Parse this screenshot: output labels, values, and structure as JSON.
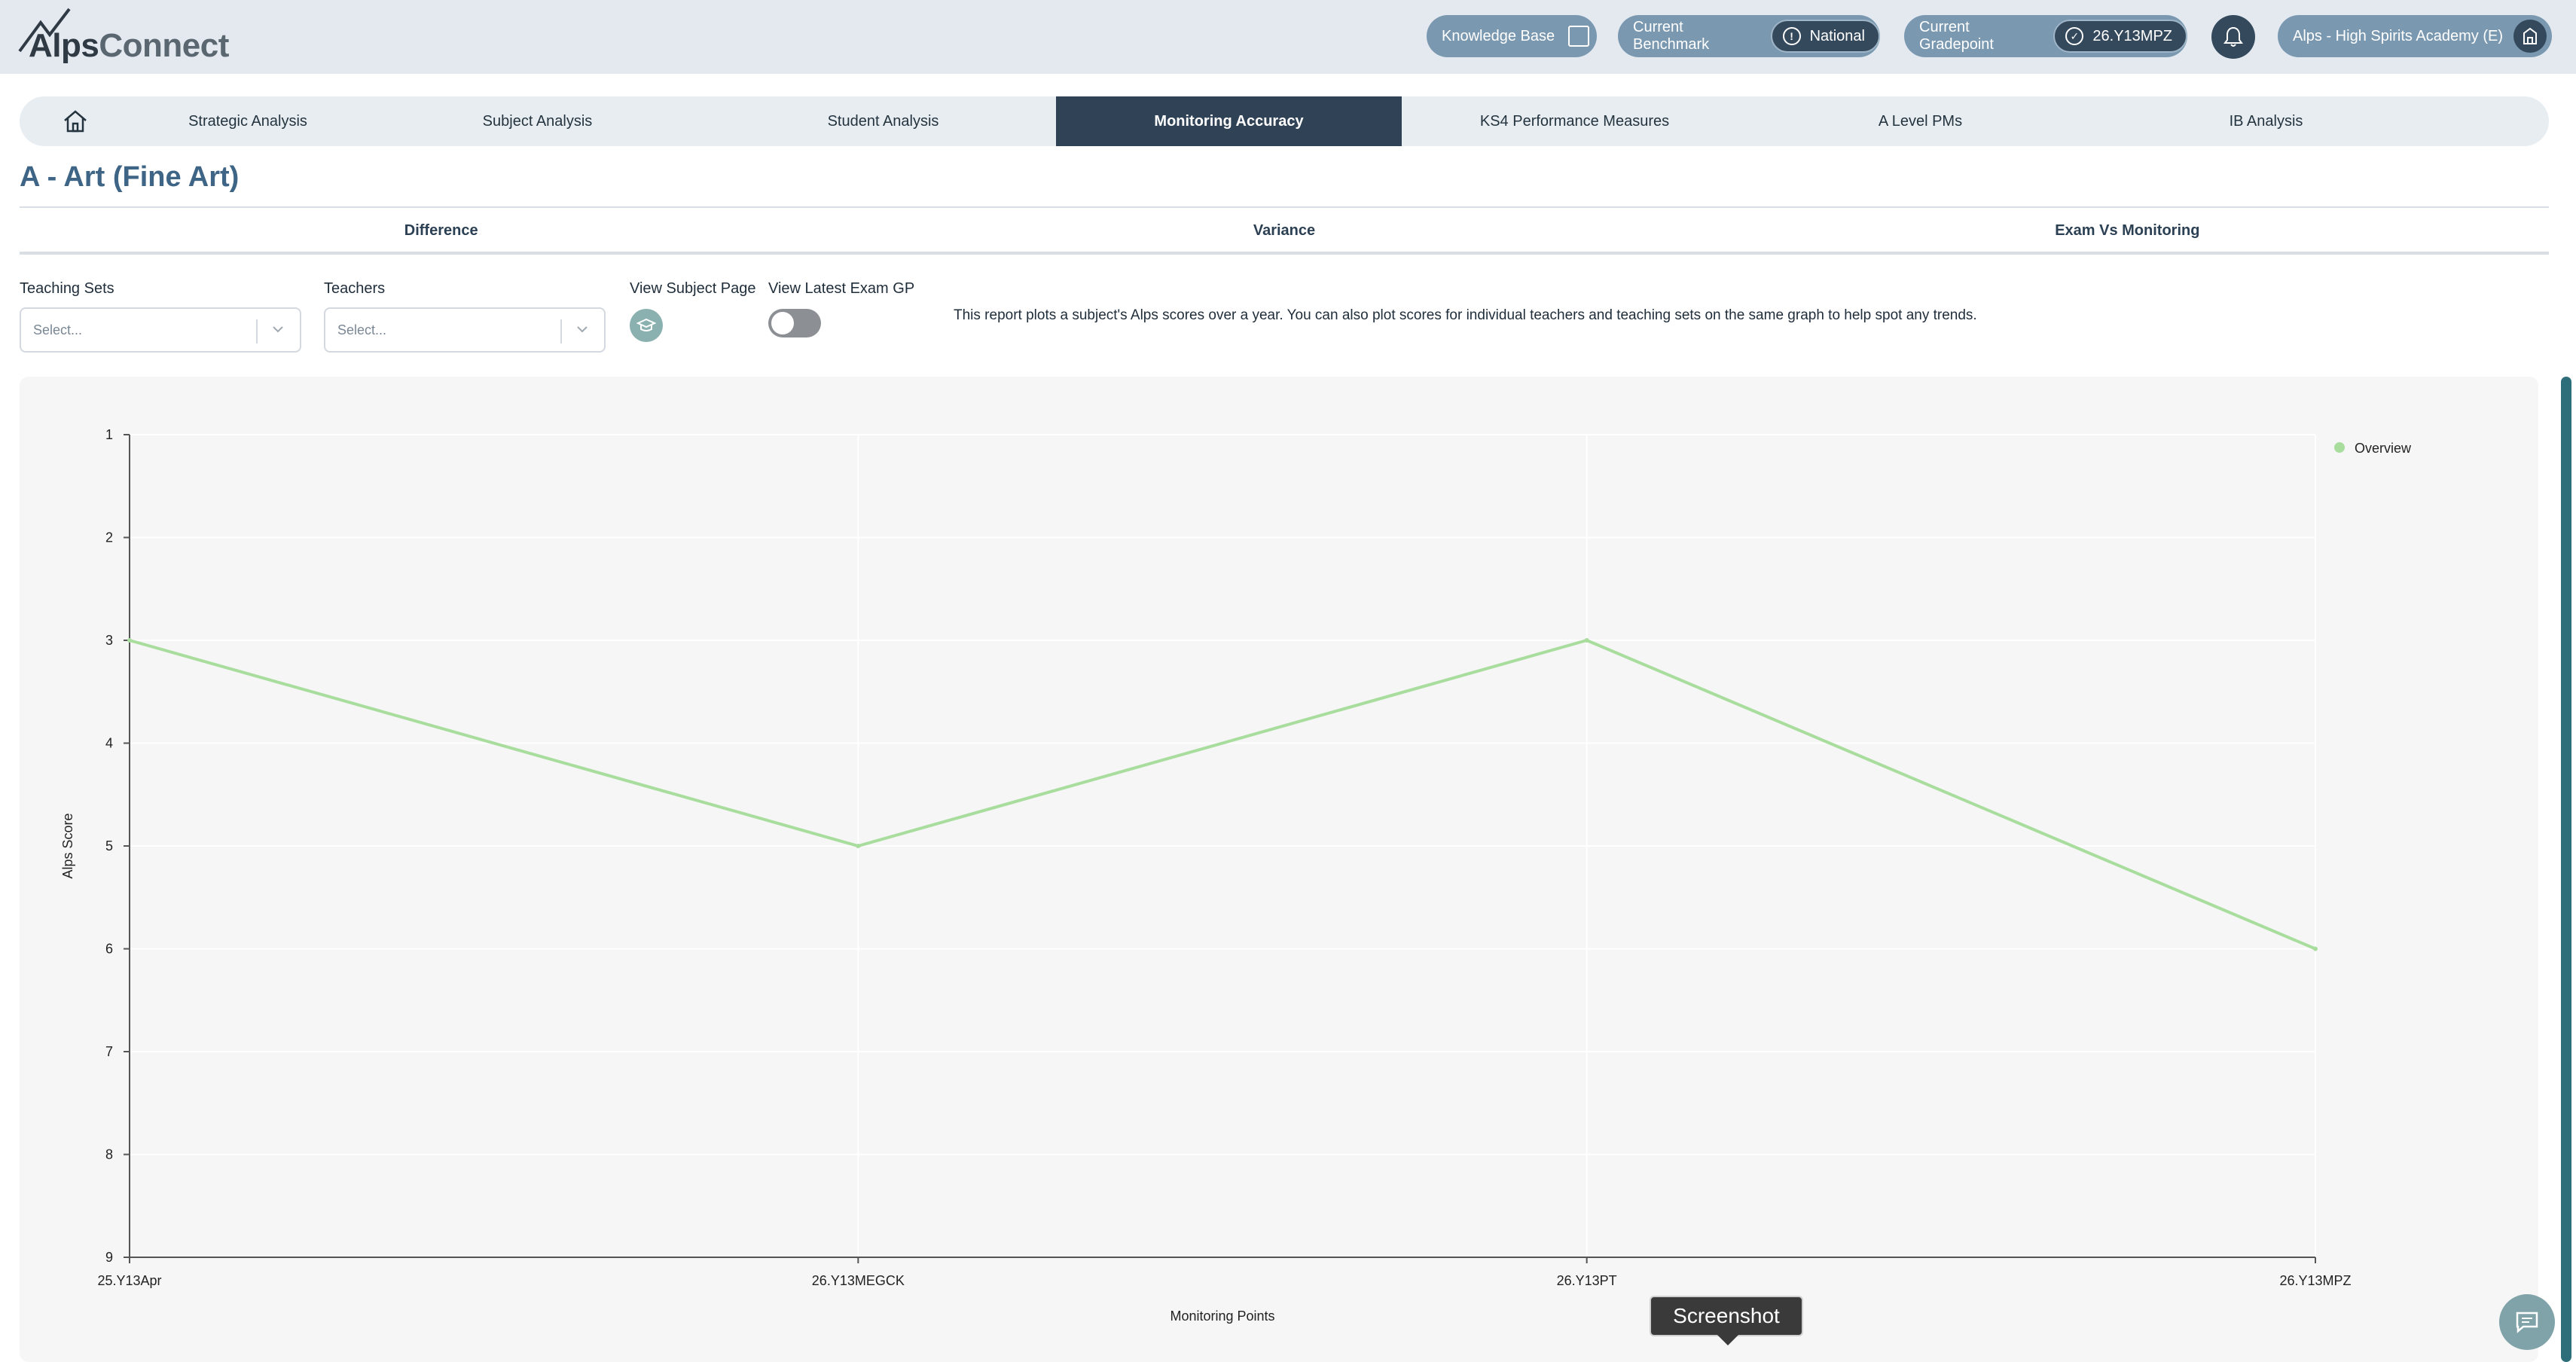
{
  "header": {
    "logo": {
      "alps": "Alps",
      "connect": "Connect"
    },
    "knowledge_base": "Knowledge Base",
    "benchmark": {
      "label": "Current Benchmark",
      "value": "National"
    },
    "gradepoint": {
      "label": "Current Gradepoint",
      "value": "26.Y13MPZ"
    },
    "school": "Alps - High Spirits Academy (E)"
  },
  "nav": {
    "items": [
      {
        "label": "Strategic Analysis"
      },
      {
        "label": "Subject Analysis"
      },
      {
        "label": "Student Analysis"
      },
      {
        "label": "Monitoring Accuracy",
        "active": true
      },
      {
        "label": "KS4 Performance Measures"
      },
      {
        "label": "A Level PMs"
      },
      {
        "label": "IB Analysis"
      }
    ]
  },
  "page": {
    "title": "A - Art (Fine Art)",
    "subtabs": [
      "Difference",
      "Variance",
      "Exam Vs Monitoring"
    ]
  },
  "filters": {
    "teaching_sets": {
      "label": "Teaching Sets",
      "placeholder": "Select..."
    },
    "teachers": {
      "label": "Teachers",
      "placeholder": "Select..."
    },
    "view_subject_page": "View Subject Page",
    "view_latest_exam_gp": {
      "label": "View Latest Exam GP",
      "on": false
    },
    "description": "This report plots a subject's Alps scores over a year. You can also plot scores for individual teachers and teaching sets on the same graph to help spot any trends."
  },
  "chart_data": {
    "type": "line",
    "x": [
      "25.Y13Apr",
      "26.Y13MEGCK",
      "26.Y13PT",
      "26.Y13MPZ"
    ],
    "series": [
      {
        "name": "Overview",
        "values": [
          3,
          5,
          3,
          6
        ]
      }
    ],
    "xlabel": "Monitoring Points",
    "ylabel": "Alps Score",
    "ylim": [
      1,
      9
    ],
    "y_inverted": true,
    "y_ticks": [
      "1",
      "2",
      "3",
      "4",
      "5",
      "6",
      "7",
      "8",
      "9"
    ],
    "grid": true,
    "legend_position": "top-right",
    "series_color": "#a8dd9e"
  },
  "overlay": {
    "tooltip": "Screenshot"
  }
}
